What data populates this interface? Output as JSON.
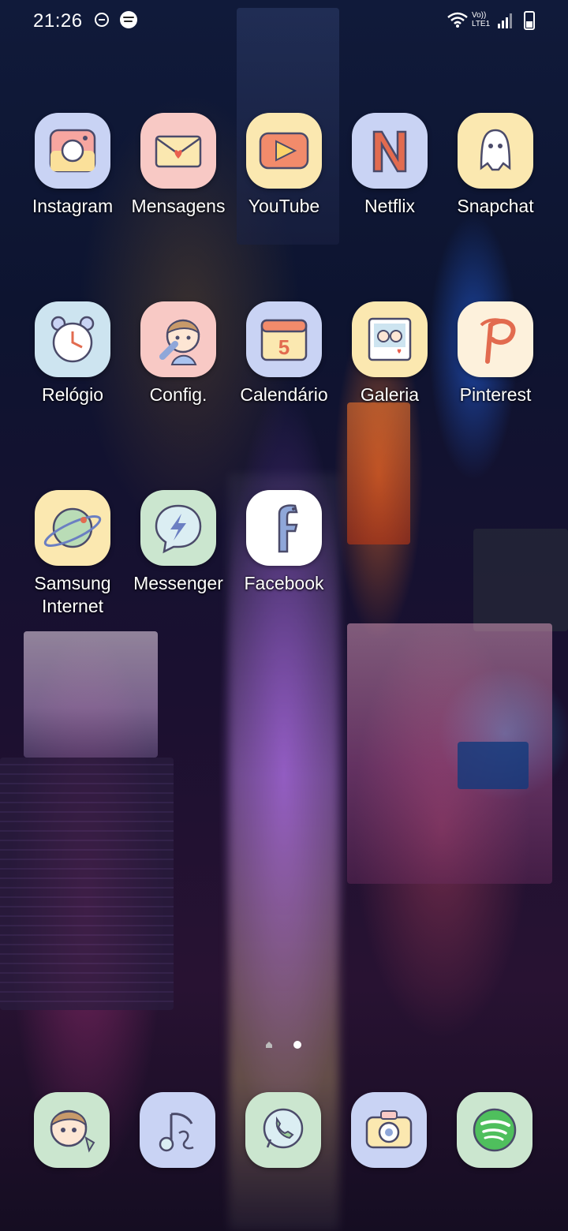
{
  "status_bar": {
    "time": "21:26",
    "network_label_top": "Vo))",
    "network_label_bottom": "LTE1",
    "icons": [
      "do-not-disturb-icon",
      "spotify-notification-icon",
      "wifi-icon",
      "signal-icon",
      "battery-icon"
    ]
  },
  "home_screen": {
    "apps": [
      {
        "label": "Instagram",
        "icon": "instagram-icon"
      },
      {
        "label": "Mensagens",
        "icon": "messages-envelope-icon"
      },
      {
        "label": "YouTube",
        "icon": "youtube-play-icon"
      },
      {
        "label": "Netflix",
        "icon": "netflix-n-icon"
      },
      {
        "label": "Snapchat",
        "icon": "snapchat-ghost-icon"
      },
      {
        "label": "Relógio",
        "icon": "alarm-clock-icon"
      },
      {
        "label": "Config.",
        "icon": "settings-wrench-icon"
      },
      {
        "label": "Calendário",
        "icon": "calendar-icon"
      },
      {
        "label": "Galeria",
        "icon": "gallery-photo-icon"
      },
      {
        "label": "Pinterest",
        "icon": "pinterest-p-icon"
      },
      {
        "label": "Samsung\nInternet",
        "icon": "planet-icon"
      },
      {
        "label": "Messenger",
        "icon": "messenger-bolt-icon"
      },
      {
        "label": "Facebook",
        "icon": "facebook-f-icon"
      }
    ],
    "calendar_day": "5"
  },
  "page_indicator": {
    "pages": 2,
    "active_page": 1
  },
  "dock": {
    "apps": [
      {
        "icon": "phone-contact-icon"
      },
      {
        "icon": "music-note-icon"
      },
      {
        "icon": "whatsapp-icon"
      },
      {
        "icon": "camera-icon"
      },
      {
        "icon": "spotify-icon"
      }
    ]
  },
  "colors": {
    "icon_blue": "#c9d3f4",
    "icon_pink": "#f8c9c5",
    "icon_yellow": "#fbe8b0",
    "icon_green": "#cbe6cf",
    "icon_outline": "#4b4b6a"
  }
}
